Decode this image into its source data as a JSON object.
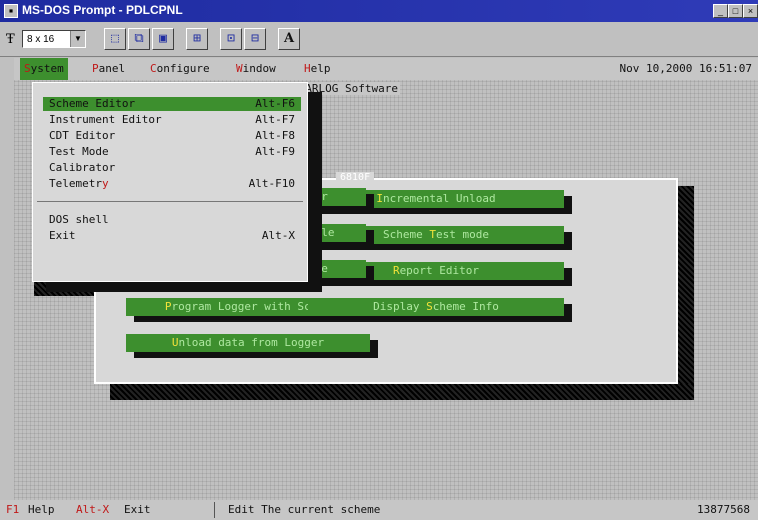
{
  "window": {
    "title": "MS-DOS Prompt - PDLCPNL",
    "controls": [
      "_",
      "□",
      "×"
    ]
  },
  "toolbar": {
    "font_icon": "Ŧ",
    "font_size": "8 x 16",
    "buttons": [
      {
        "name": "mark-icon",
        "glyph": "⬚"
      },
      {
        "name": "copy-icon",
        "glyph": "⧉"
      },
      {
        "name": "paste-icon",
        "glyph": "▣"
      },
      {
        "name": "fullscreen-icon",
        "glyph": "⊞"
      },
      {
        "name": "properties-icon",
        "glyph": "⊡"
      },
      {
        "name": "background-icon",
        "glyph": "⊟"
      },
      {
        "name": "font-icon",
        "glyph": "A"
      }
    ]
  },
  "menubar": {
    "items": [
      {
        "hk": "S",
        "rest": "ystem",
        "active": true
      },
      {
        "hk": "P",
        "rest": "anel",
        "active": false
      },
      {
        "hk": "C",
        "rest": "onfigure",
        "active": false
      },
      {
        "hk": "W",
        "rest": "indow",
        "active": false
      },
      {
        "hk": "H",
        "rest": "elp",
        "active": false
      }
    ],
    "datetime": "Nov 10,2000 16:51:07"
  },
  "banner": "STARLOG Software",
  "system_menu": {
    "items": [
      {
        "label": "Scheme Editor",
        "hk_index": -1,
        "shortcut": "Alt-F6",
        "selected": true
      },
      {
        "label": "Instrument Editor",
        "hk_index": -1,
        "shortcut": "Alt-F7",
        "selected": false
      },
      {
        "label": "CDT Editor",
        "hk_index": -1,
        "shortcut": "Alt-F8",
        "selected": false
      },
      {
        "label": "Test Mode",
        "hk_index": -1,
        "shortcut": "Alt-F9",
        "selected": false
      },
      {
        "label": "Calibrator",
        "hk_index": -1,
        "shortcut": "",
        "selected": false
      },
      {
        "label": "Telemetry",
        "hk_index": 8,
        "shortcut": "Alt-F10",
        "selected": false
      }
    ],
    "items2": [
      {
        "label": "DOS shell",
        "shortcut": ""
      },
      {
        "label": "Exit",
        "shortcut": "Alt-X"
      }
    ]
  },
  "main_window": {
    "frame_title": "6810F",
    "buttons": [
      {
        "name": "incremental-unload-button",
        "hk": "I",
        "rest": "ncremental Unload"
      },
      {
        "name": "scheme-test-mode-button",
        "pre": "Scheme ",
        "hk": "T",
        "rest": "est mode"
      },
      {
        "name": "report-editor-button",
        "hk": "R",
        "rest": "eport Editor"
      },
      {
        "name": "program-logger-button",
        "hk": "P",
        "rest": "rogram Logger with Scheme"
      },
      {
        "name": "display-scheme-info-button",
        "pre": "Display ",
        "hk": "S",
        "rest": "cheme Info"
      },
      {
        "name": "unload-data-button",
        "hk": "U",
        "rest": "nload data from Logger"
      }
    ],
    "partial_buttons": [
      "ler",
      "file",
      "ule"
    ]
  },
  "status": {
    "f1": "F1",
    "f1_label": "Help",
    "altx": "Alt-X",
    "altx_label": "Exit",
    "message": "Edit The current scheme",
    "counter": "13877568"
  },
  "colors": {
    "accent": "#3d8f2e",
    "title": "#1e2ba0",
    "hotkey": "#c01818"
  }
}
